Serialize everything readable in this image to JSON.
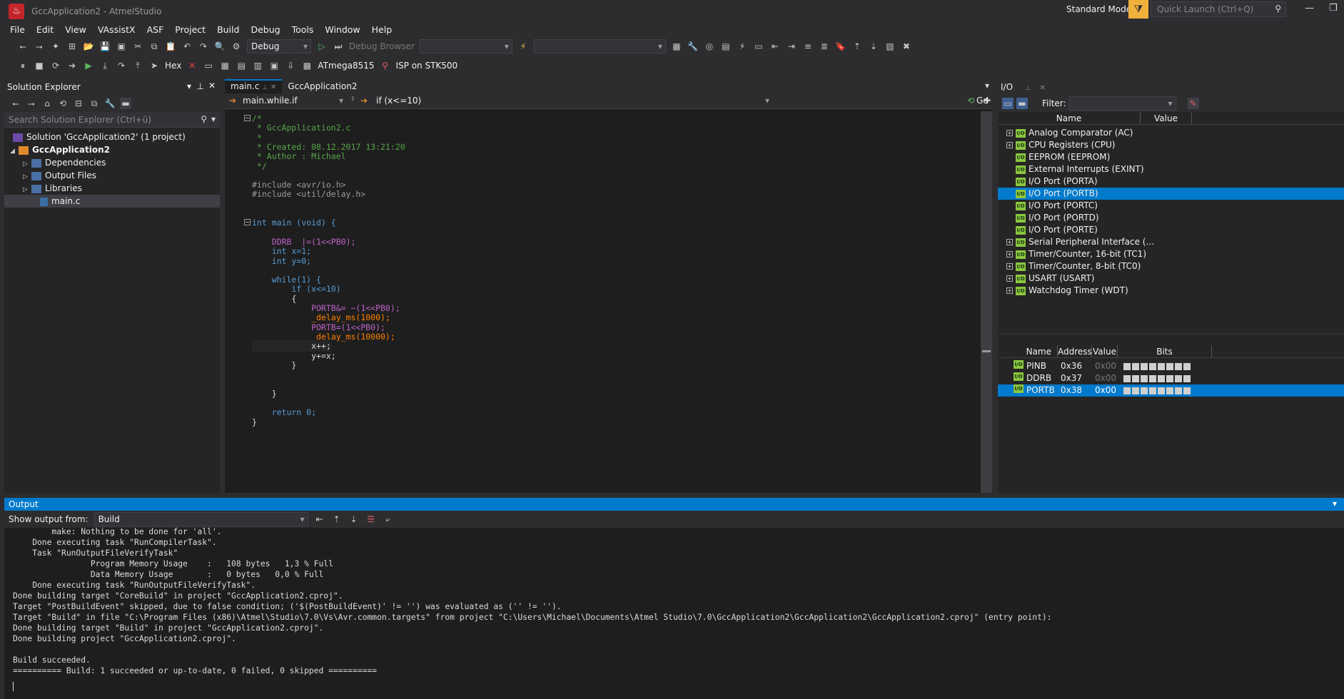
{
  "window": {
    "title": "GccApplication2 - AtmelStudio",
    "logo": "atmel-logo",
    "mode": "Standard Mode",
    "quick_launch_placeholder": "Quick Launch (Ctrl+Q)"
  },
  "menu": [
    "File",
    "Edit",
    "View",
    "VAssistX",
    "ASF",
    "Project",
    "Build",
    "Debug",
    "Tools",
    "Window",
    "Help"
  ],
  "toolbar": {
    "config": "Debug",
    "debug_browser": "Debug Browser",
    "hex": "Hex",
    "device": "ATmega8515",
    "tool": "ISP on STK500"
  },
  "solution_explorer": {
    "title": "Solution Explorer",
    "search_placeholder": "Search Solution Explorer (Ctrl+ü)",
    "items": [
      "Solution 'GccApplication2' (1 project)",
      "GccApplication2",
      "Dependencies",
      "Output Files",
      "Libraries",
      "main.c"
    ]
  },
  "editor": {
    "tabs": [
      "main.c",
      "GccApplication2"
    ],
    "nav_scope": "main.while.if",
    "nav_member": "if (x<=10)",
    "go": "Go",
    "code": [
      {
        "t": "/*",
        "c": "com"
      },
      {
        "t": " * GccApplication2.c",
        "c": "com"
      },
      {
        "t": " *",
        "c": "com"
      },
      {
        "t": " * Created: 08.12.2017 13:21:20",
        "c": "com"
      },
      {
        "t": " * Author : Michael",
        "c": "com"
      },
      {
        "t": " */",
        "c": "com"
      },
      {
        "t": "",
        "c": "id"
      },
      {
        "t": "#include <avr/io.h>",
        "c": "pp"
      },
      {
        "t": "#include <util/delay.h>",
        "c": "pp"
      },
      {
        "t": "",
        "c": "id"
      },
      {
        "t": "",
        "c": "id"
      },
      {
        "t": "int main (void) {",
        "c": "kw"
      },
      {
        "t": "",
        "c": "id"
      },
      {
        "t": "    DDRB  |=(1<<PB0);",
        "c": "mac"
      },
      {
        "t": "    int x=1;",
        "c": "kw"
      },
      {
        "t": "    int y=0;",
        "c": "kw"
      },
      {
        "t": "",
        "c": "id"
      },
      {
        "t": "    while(1) {",
        "c": "kw"
      },
      {
        "t": "        if (x<=10)",
        "c": "kw"
      },
      {
        "t": "        {",
        "c": "id"
      },
      {
        "t": "            PORTB&= ~(1<<PB0);",
        "c": "mac"
      },
      {
        "t": "            _delay_ms(1000);",
        "c": "fn"
      },
      {
        "t": "            PORTB=(1<<PB0);",
        "c": "mac"
      },
      {
        "t": "            _delay_ms(10000);",
        "c": "fn"
      },
      {
        "t": "            x++;",
        "c": "id"
      },
      {
        "t": "            y+=x;",
        "c": "id"
      },
      {
        "t": "        }",
        "c": "id"
      },
      {
        "t": "",
        "c": "id"
      },
      {
        "t": "",
        "c": "id"
      },
      {
        "t": "    }",
        "c": "id"
      },
      {
        "t": "",
        "c": "id"
      },
      {
        "t": "    return 0;",
        "c": "kw"
      },
      {
        "t": "}",
        "c": "id"
      }
    ]
  },
  "io": {
    "title": "I/O",
    "filter_label": "Filter:",
    "cols": [
      "Name",
      "Value"
    ],
    "peripherals": [
      {
        "name": "Analog Comparator (AC)",
        "expand": true
      },
      {
        "name": "CPU Registers (CPU)",
        "expand": true
      },
      {
        "name": "EEPROM (EEPROM)",
        "expand": false
      },
      {
        "name": "External Interrupts (EXINT)",
        "expand": false
      },
      {
        "name": "I/O Port (PORTA)",
        "expand": false
      },
      {
        "name": "I/O Port (PORTB)",
        "expand": false,
        "selected": true
      },
      {
        "name": "I/O Port (PORTC)",
        "expand": false
      },
      {
        "name": "I/O Port (PORTD)",
        "expand": false
      },
      {
        "name": "I/O Port (PORTE)",
        "expand": false
      },
      {
        "name": "Serial Peripheral Interface (...",
        "expand": true
      },
      {
        "name": "Timer/Counter, 16-bit (TC1)",
        "expand": true
      },
      {
        "name": "Timer/Counter, 8-bit (TC0)",
        "expand": true
      },
      {
        "name": "USART (USART)",
        "expand": true
      },
      {
        "name": "Watchdog Timer (WDT)",
        "expand": true
      }
    ],
    "reg_cols": [
      "Name",
      "Address",
      "Value",
      "Bits"
    ],
    "registers": [
      {
        "name": "PINB",
        "address": "0x36",
        "value": "0x00"
      },
      {
        "name": "DDRB",
        "address": "0x37",
        "value": "0x00"
      },
      {
        "name": "PORTB",
        "address": "0x38",
        "value": "0x00",
        "selected": true
      }
    ]
  },
  "output": {
    "title": "Output",
    "show_from_label": "Show output from:",
    "source": "Build",
    "lines": [
      "        make: Nothing to be done for 'all'.",
      "    Done executing task \"RunCompilerTask\".",
      "    Task \"RunOutputFileVerifyTask\"",
      "                Program Memory Usage    :   108 bytes   1,3 % Full",
      "                Data Memory Usage       :   0 bytes   0,0 % Full",
      "    Done executing task \"RunOutputFileVerifyTask\".",
      "Done building target \"CoreBuild\" in project \"GccApplication2.cproj\".",
      "Target \"PostBuildEvent\" skipped, due to false condition; ('$(PostBuildEvent)' != '') was evaluated as ('' != '').",
      "Target \"Build\" in file \"C:\\Program Files (x86)\\Atmel\\Studio\\7.0\\Vs\\Avr.common.targets\" from project \"C:\\Users\\Michael\\Documents\\Atmel Studio\\7.0\\GccApplication2\\GccApplication2\\GccApplication2.cproj\" (entry point):",
      "Done building target \"Build\" in project \"GccApplication2.cproj\".",
      "Done building project \"GccApplication2.cproj\".",
      "",
      "Build succeeded.",
      "========== Build: 1 succeeded or up-to-date, 0 failed, 0 skipped =========="
    ]
  }
}
